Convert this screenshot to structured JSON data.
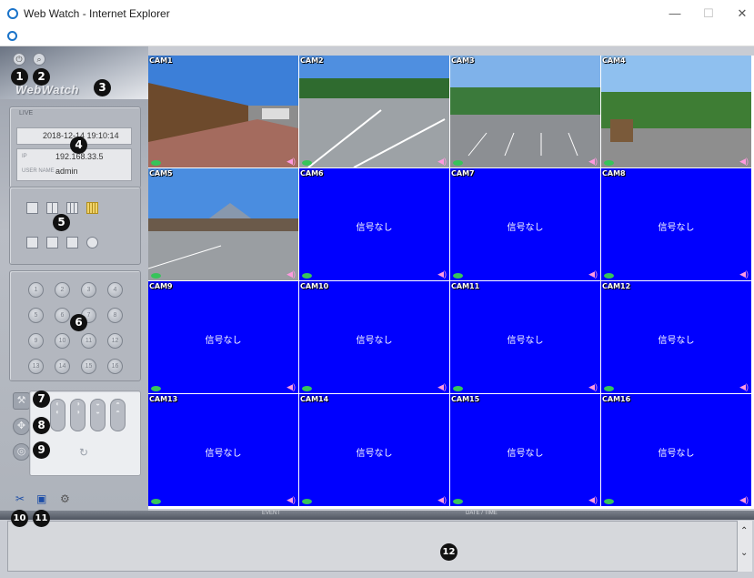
{
  "window": {
    "title": "Web Watch - Internet Explorer",
    "minimize": "—",
    "maximize": "☐",
    "close": "✕"
  },
  "sidebar": {
    "logo": "WebWatch",
    "info": {
      "header": "LIVE",
      "datetime": "2018-12-14 19:10:14",
      "ip_label": "IP",
      "ip": "192.168.33.5",
      "user_label": "USER NAME",
      "user": "admin"
    },
    "channel_buttons": [
      "1",
      "2",
      "3",
      "4",
      "5",
      "6",
      "7",
      "8",
      "9",
      "10",
      "11",
      "12",
      "13",
      "14",
      "15",
      "16"
    ]
  },
  "badges": [
    "1",
    "2",
    "3",
    "4",
    "5",
    "6",
    "7",
    "8",
    "9",
    "10",
    "11",
    "12"
  ],
  "cameras": [
    {
      "label": "CAM1",
      "no_signal": ""
    },
    {
      "label": "CAM2",
      "no_signal": ""
    },
    {
      "label": "CAM3",
      "no_signal": ""
    },
    {
      "label": "CAM4",
      "no_signal": ""
    },
    {
      "label": "CAM5",
      "no_signal": ""
    },
    {
      "label": "CAM6",
      "no_signal": "信号なし"
    },
    {
      "label": "CAM7",
      "no_signal": "信号なし"
    },
    {
      "label": "CAM8",
      "no_signal": "信号なし"
    },
    {
      "label": "CAM9",
      "no_signal": "信号なし"
    },
    {
      "label": "CAM10",
      "no_signal": "信号なし"
    },
    {
      "label": "CAM11",
      "no_signal": "信号なし"
    },
    {
      "label": "CAM12",
      "no_signal": "信号なし"
    },
    {
      "label": "CAM13",
      "no_signal": "信号なし"
    },
    {
      "label": "CAM14",
      "no_signal": "信号なし"
    },
    {
      "label": "CAM15",
      "no_signal": "信号なし"
    },
    {
      "label": "CAM16",
      "no_signal": "信号なし"
    }
  ],
  "status_bar": {
    "event": "EVENT",
    "datetime": "DATE / TIME"
  },
  "colors": {
    "no_signal_bg": "#0000ff",
    "active_border": "#3fd46b",
    "badge": "#111111"
  }
}
